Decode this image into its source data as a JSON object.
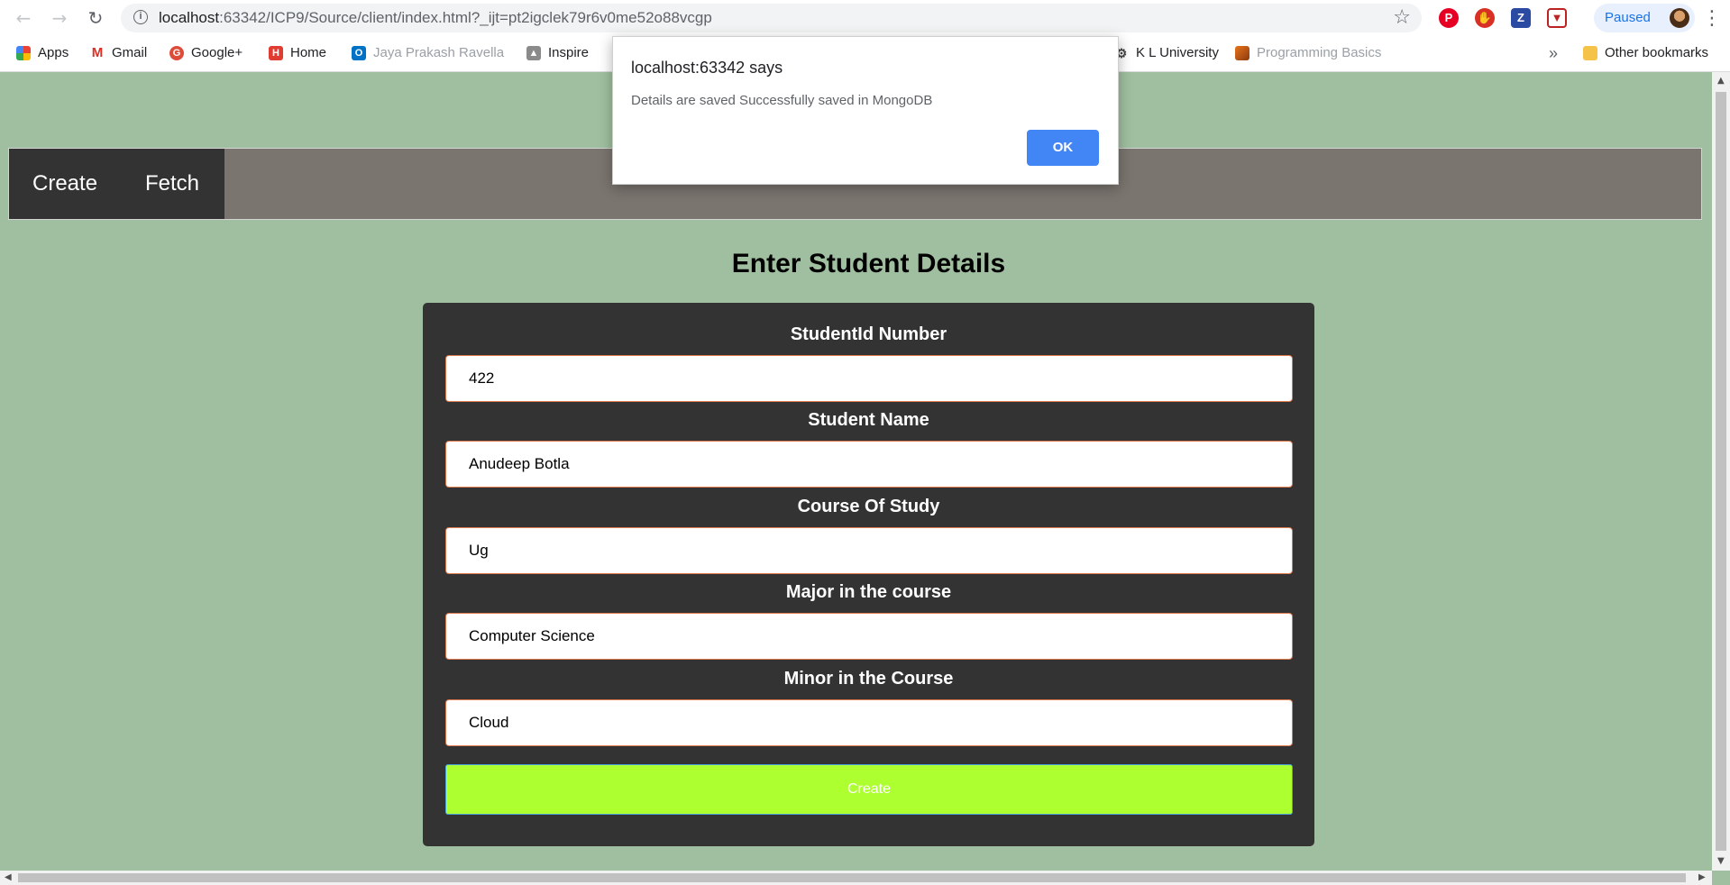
{
  "browser": {
    "url_host": "localhost",
    "url_rest": ":63342/ICP9/Source/client/index.html?_ijt=pt2igclek79r6v0me52o88vcgp",
    "profile_label": "Paused"
  },
  "bookmarks": [
    {
      "label": "Apps",
      "icon": "apps-grid-icon"
    },
    {
      "label": "Gmail",
      "icon": "gmail-icon"
    },
    {
      "label": "Google+",
      "icon": "google-plus-icon"
    },
    {
      "label": "Home",
      "icon": "home-site-icon"
    },
    {
      "label": "Jaya Prakash Ravella",
      "icon": "outlook-icon"
    },
    {
      "label": "Inspire",
      "icon": "inspire-icon"
    },
    {
      "label": "K L University",
      "icon": "gear-icon"
    },
    {
      "label": "Programming Basics",
      "icon": "programming-icon"
    },
    {
      "label": "Other bookmarks",
      "icon": "folder-icon"
    }
  ],
  "nav": {
    "tabs": [
      "Create",
      "Fetch"
    ]
  },
  "form": {
    "title": "Enter Student Details",
    "fields": [
      {
        "label": "StudentId Number",
        "value": "422"
      },
      {
        "label": "Student Name",
        "value": "Anudeep Botla"
      },
      {
        "label": "Course Of Study",
        "value": "Ug"
      },
      {
        "label": "Major in the course",
        "value": "Computer Science"
      },
      {
        "label": "Minor in the Course",
        "value": "Cloud"
      }
    ],
    "submit_label": "Create"
  },
  "dialog": {
    "title": "localhost:63342 says",
    "message": "Details are saved Successfully saved in MongoDB",
    "ok_label": "OK"
  },
  "colors": {
    "page_bg": "#a0bfa0",
    "navbar_bg": "#7b756f",
    "nav_tabs_bg": "#333333",
    "card_bg": "#333333",
    "submit_bg": "#adff2f",
    "dialog_button": "#4285f4"
  }
}
